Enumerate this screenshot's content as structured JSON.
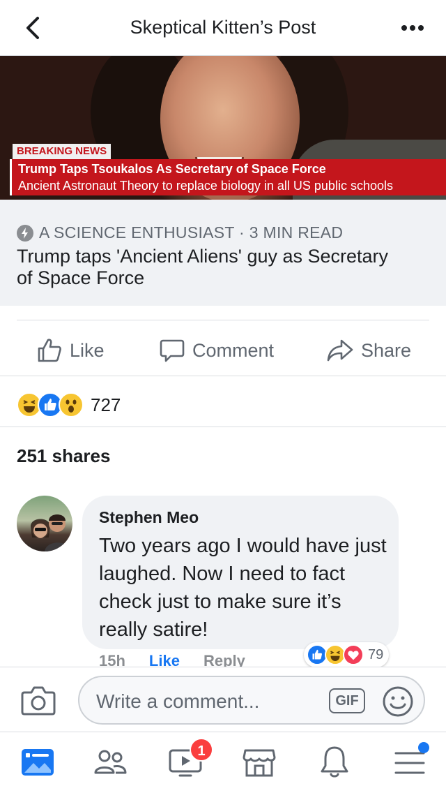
{
  "header": {
    "title": "Skeptical Kitten’s Post"
  },
  "hero_image": {
    "breaking_label": "BREAKING NEWS",
    "headline": "Trump Taps Tsoukalos As Secretary of Space Force",
    "subline": "Ancient Astronaut Theory to replace biology in all US public schools"
  },
  "link_preview": {
    "source": "A SCIENCE ENTHUSIAST · 3 MIN READ",
    "title": "Trump taps 'Ancient Aliens' guy as Secretary of Space Force"
  },
  "actions": {
    "like": "Like",
    "comment": "Comment",
    "share": "Share"
  },
  "reactions": {
    "count": "727"
  },
  "shares": "251 shares",
  "comment": {
    "author": "Stephen Meo",
    "text": "Two years ago I would have just laughed. Now I need to fact check just to make sure it’s really satire!",
    "time": "15h",
    "like_label": "Like",
    "reply_label": "Reply",
    "reaction_count": "79"
  },
  "composer": {
    "placeholder": "Write a comment...",
    "gif_label": "GIF"
  },
  "tabbar": {
    "watch_badge": "1"
  },
  "colors": {
    "accent": "#1877f2",
    "news_red": "#c4161c",
    "badge_red": "#fa3e3e"
  }
}
